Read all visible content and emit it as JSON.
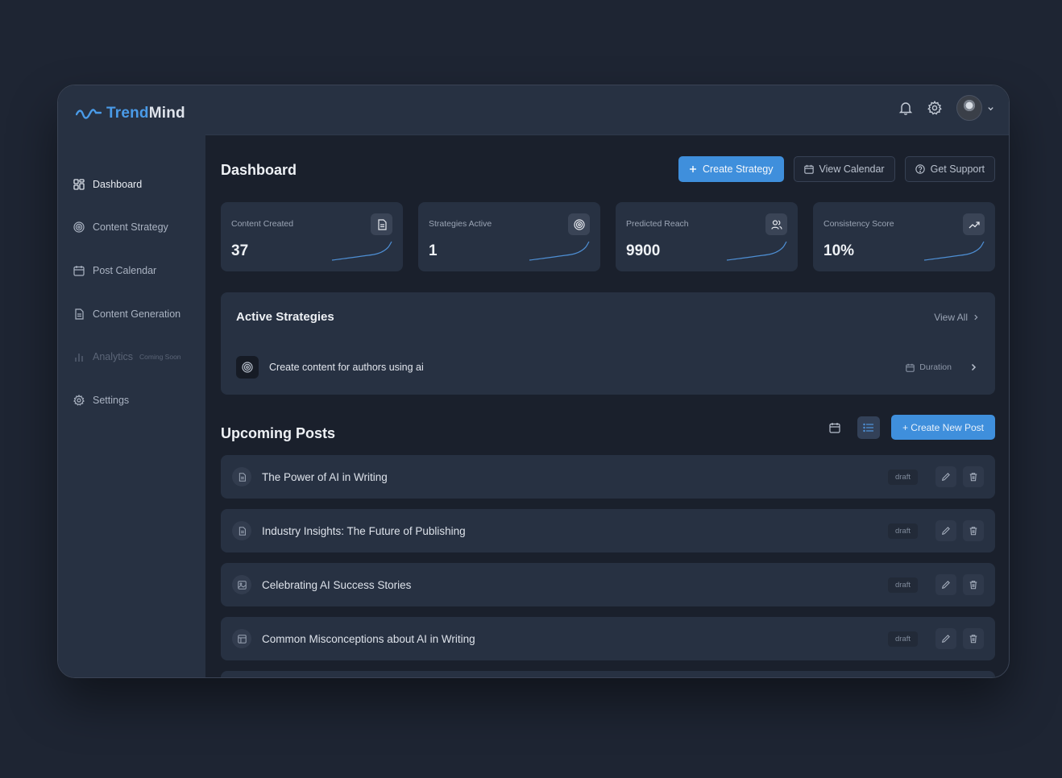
{
  "brand": {
    "part1": "Trend",
    "part2": "Mind"
  },
  "sidebar": {
    "items": [
      {
        "label": "Dashboard",
        "icon": "dashboard-icon"
      },
      {
        "label": "Content Strategy",
        "icon": "target-icon"
      },
      {
        "label": "Post Calendar",
        "icon": "calendar-icon"
      },
      {
        "label": "Content Generation",
        "icon": "document-icon"
      },
      {
        "label": "Analytics",
        "icon": "bar-chart-icon",
        "badge": "Coming Soon"
      },
      {
        "label": "Settings",
        "icon": "gear-icon"
      }
    ]
  },
  "header": {
    "title": "Dashboard"
  },
  "actions": {
    "create_strategy": "Create Strategy",
    "view_calendar": "View Calendar",
    "get_support": "Get Support"
  },
  "stats": [
    {
      "label": "Content Created",
      "value": "37",
      "icon": "document-icon"
    },
    {
      "label": "Strategies Active",
      "value": "1",
      "icon": "target-icon"
    },
    {
      "label": "Predicted Reach",
      "value": "9900",
      "icon": "users-icon"
    },
    {
      "label": "Consistency Score",
      "value": "10%",
      "icon": "trending-up-icon"
    }
  ],
  "active_strategies": {
    "title": "Active Strategies",
    "view_all": "View All",
    "items": [
      {
        "title": "Create content for authors using ai",
        "meta": "Duration"
      }
    ]
  },
  "upcoming": {
    "title": "Upcoming Posts",
    "create_label": "+ Create New Post",
    "posts": [
      {
        "title": "The Power of AI in Writing",
        "status": "draft",
        "icon": "document-icon"
      },
      {
        "title": "Industry Insights: The Future of Publishing",
        "status": "draft",
        "icon": "document-icon"
      },
      {
        "title": "Celebrating AI Success Stories",
        "status": "draft",
        "icon": "image-icon"
      },
      {
        "title": "Common Misconceptions about AI in Writing",
        "status": "draft",
        "icon": "layout-icon"
      }
    ]
  },
  "colors": {
    "accent": "#3f8fdc",
    "background": "#1a202c",
    "panel": "#273142"
  }
}
